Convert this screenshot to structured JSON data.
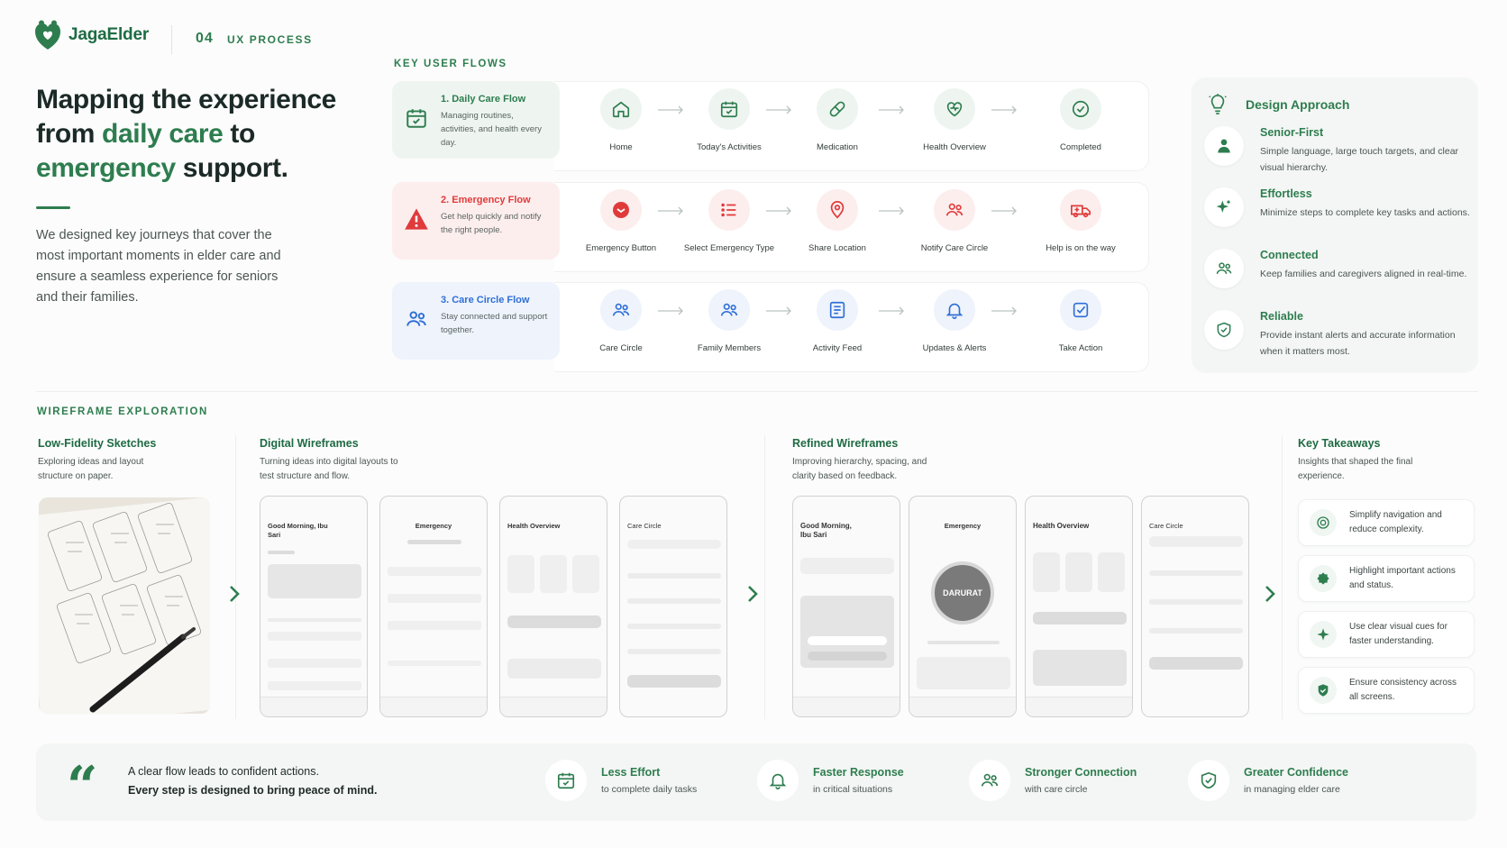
{
  "header": {
    "brand": "JagaElder",
    "section_number": "04",
    "section_name": "UX PROCESS"
  },
  "hero": {
    "title_part1": "Mapping the experience from ",
    "title_highlight1": "daily care",
    "title_part2": " to ",
    "title_highlight2": "emergency",
    "title_part3": " support.",
    "description": "We designed key journeys that cover the most important moments in elder care and ensure a seamless experience for seniors and their families."
  },
  "flows": {
    "label": "KEY USER FLOWS",
    "items": [
      {
        "title": "1. Daily Care Flow",
        "description": "Managing routines, activities, and health every day.",
        "color": "#2e7d4f",
        "steps": [
          "Home",
          "Today's Activities",
          "Medication",
          "Health Overview",
          "Completed"
        ]
      },
      {
        "title": "2. Emergency Flow",
        "description": "Get help quickly and notify the right people.",
        "color": "#e03b3b",
        "steps": [
          "Emergency Button",
          "Select Emergency Type",
          "Share Location",
          "Notify Care Circle",
          "Help is on the way"
        ]
      },
      {
        "title": "3. Care Circle Flow",
        "description": "Stay connected and support together.",
        "color": "#2f6fd6",
        "steps": [
          "Care Circle",
          "Family Members",
          "Activity Feed",
          "Updates & Alerts",
          "Take Action"
        ]
      }
    ]
  },
  "approach": {
    "title": "Design Approach",
    "items": [
      {
        "title": "Senior-First",
        "description": "Simple language, large touch targets, and clear visual hierarchy."
      },
      {
        "title": "Effortless",
        "description": "Minimize steps to complete key tasks and actions."
      },
      {
        "title": "Connected",
        "description": "Keep families and caregivers aligned in real-time."
      },
      {
        "title": "Reliable",
        "description": "Provide instant alerts and accurate information when it matters most."
      }
    ]
  },
  "wireframes": {
    "label": "WIREFRAME EXPLORATION",
    "lowfi": {
      "title": "Low-Fidelity Sketches",
      "description": "Exploring ideas and layout structure on paper."
    },
    "digital": {
      "title": "Digital Wireframes",
      "description": "Turning ideas into digital layouts to test structure and flow.",
      "screens": [
        "Good Morning, Ibu Sari",
        "Emergency",
        "Health Overview",
        "Care Circle"
      ]
    },
    "refined": {
      "title": "Refined Wireframes",
      "description": "Improving hierarchy, spacing, and clarity based on feedback.",
      "screens": [
        "Good Morning, Ibu Sari",
        "Emergency",
        "Health Overview",
        "Care Circle"
      ],
      "emergency_button": "DARURAT"
    },
    "takeaways": {
      "title": "Key Takeaways",
      "description": "Insights that shaped the final experience.",
      "items": [
        "Simplify navigation and reduce complexity.",
        "Highlight important actions and status.",
        "Use clear visual cues for faster understanding.",
        "Ensure consistency across all screens."
      ]
    }
  },
  "bottom": {
    "quote_line1": "A clear flow leads to confident actions.",
    "quote_line2": "Every step is designed to bring peace of mind.",
    "metrics": [
      {
        "title": "Less Effort",
        "description": "to complete daily tasks"
      },
      {
        "title": "Faster Response",
        "description": "in critical situations"
      },
      {
        "title": "Stronger Connection",
        "description": "with care circle"
      },
      {
        "title": "Greater Confidence",
        "description": "in managing elder care"
      }
    ]
  }
}
